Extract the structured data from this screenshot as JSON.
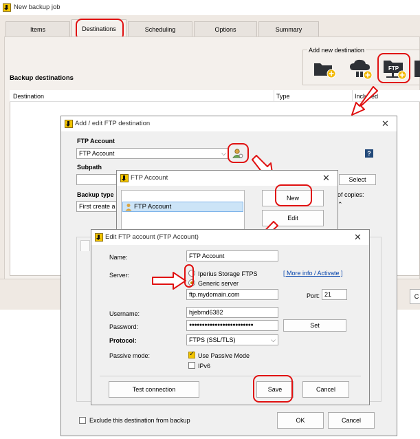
{
  "main_window": {
    "title": "New backup job",
    "tabs": [
      "Items",
      "Destinations",
      "Scheduling",
      "Options",
      "Summary"
    ],
    "selected_tab": "Destinations",
    "add_destination_label": "Add new destination",
    "section_title": "Backup destinations",
    "columns": [
      "Destination",
      "Type",
      "Included"
    ],
    "ftp_tile_label": "FTP"
  },
  "ftp_dest_dialog": {
    "title": "Add / edit FTP destination",
    "ftp_account_label": "FTP Account",
    "ftp_account_value": "FTP Account",
    "subpath_label": "Subpath",
    "select_button": "Select",
    "backup_type_label": "Backup type",
    "backup_type_value": "First create a",
    "copies_label": "of copies:",
    "exclude_label": "Exclude this destination from backup",
    "ok_button": "OK",
    "cancel_button": "Cancel",
    "help_icon": "?"
  },
  "ftp_account_list": {
    "title": "FTP Account",
    "item": "FTP Account",
    "new_button": "New",
    "edit_button": "Edit"
  },
  "edit_ftp_dialog": {
    "title": "Edit FTP account (FTP Account)",
    "name_label": "Name:",
    "name_value": "FTP Account",
    "server_label": "Server:",
    "option_iperius": "Iperius Storage FTPS",
    "option_generic": "Generic server",
    "more_info_link": "[ More info / Activate ]",
    "server_value": "ftp.mydomain.com",
    "port_label": "Port:",
    "port_value": "21",
    "username_label": "Username:",
    "username_value": "hjebmd6382",
    "password_label": "Password:",
    "password_value": "●●●●●●●●●●●●●●●●●●●●●●●●●",
    "set_button": "Set",
    "protocol_label": "Protocol:",
    "protocol_value": "FTPS (SSL/TLS)",
    "passive_label": "Passive mode:",
    "passive_option": "Use Passive Mode",
    "ipv6_option": "IPv6",
    "test_button": "Test connection",
    "save_button": "Save",
    "cancel_button": "Cancel"
  },
  "colors": {
    "accent_yellow": "#f2c400",
    "annotation_red": "#e01010",
    "link_blue": "#0645ad"
  }
}
